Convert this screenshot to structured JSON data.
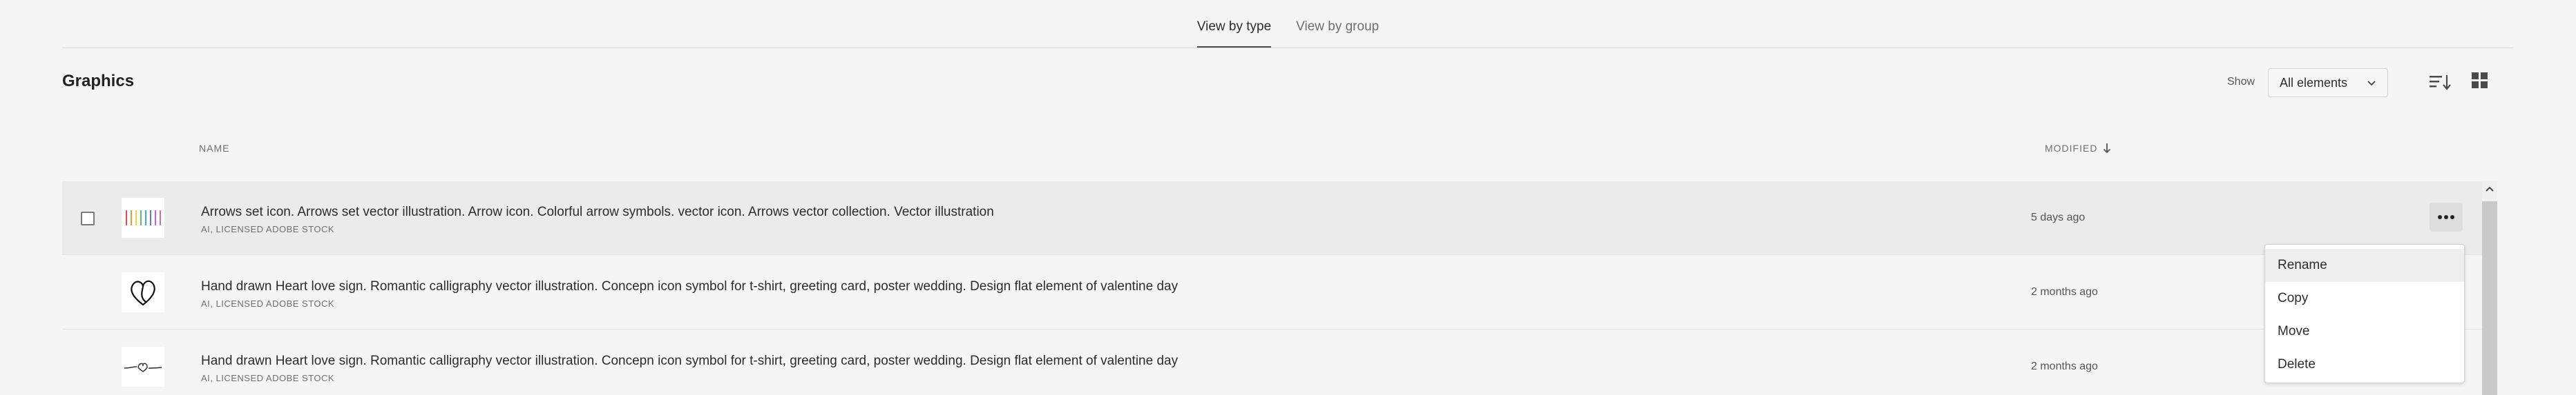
{
  "tabs": [
    {
      "label": "View by type",
      "active": true
    },
    {
      "label": "View by group",
      "active": false
    }
  ],
  "section": {
    "title": "Graphics"
  },
  "filter": {
    "show_label": "Show",
    "selected": "All elements"
  },
  "columns": {
    "name": "NAME",
    "modified": "MODIFIED"
  },
  "rows": [
    {
      "title": "Arrows set icon. Arrows set vector illustration. Arrow icon. Colorful arrow symbols. vector icon. Arrows vector collection. Vector illustration",
      "meta": "AI, LICENSED ADOBE STOCK",
      "modified": "5 days ago"
    },
    {
      "title": "Hand drawn Heart love sign. Romantic calligraphy vector illustration. Concepn icon symbol for t-shirt, greeting card, poster wedding. Design flat element of valentine day",
      "meta": "AI, LICENSED ADOBE STOCK",
      "modified": "2 months ago"
    },
    {
      "title": "Hand drawn Heart love sign. Romantic calligraphy vector illustration. Concepn icon symbol for t-shirt, greeting card, poster wedding. Design flat element of valentine day",
      "meta": "AI, LICENSED ADOBE STOCK",
      "modified": "2 months ago"
    }
  ],
  "context_menu": {
    "items": [
      "Rename",
      "Copy",
      "Move",
      "Delete"
    ]
  },
  "icons": {
    "sort": "sort-icon",
    "grid": "grid-view-icon",
    "more": "more-icon",
    "chevron": "chevron-down-icon",
    "arrow": "arrow-down-icon"
  }
}
